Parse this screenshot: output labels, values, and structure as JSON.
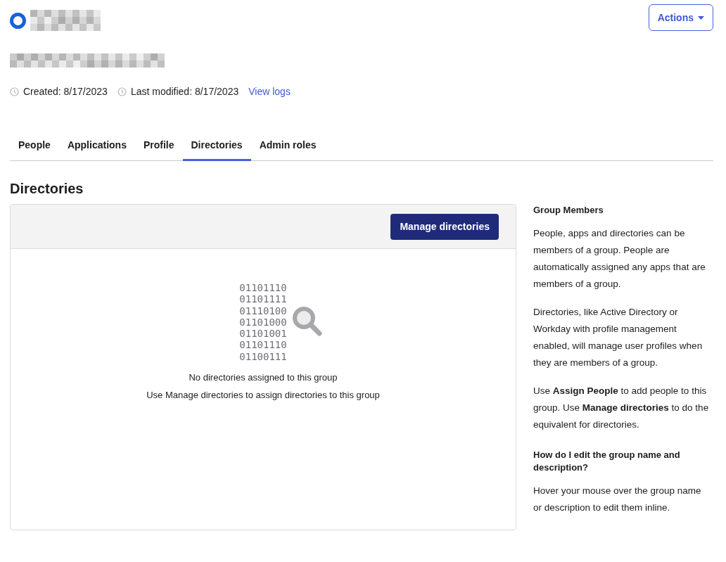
{
  "header": {
    "name_redacted": true,
    "description_redacted": true,
    "actions_button": "Actions"
  },
  "meta": {
    "created": "Created: 8/17/2023",
    "modified": "Last modified: 8/17/2023",
    "link": "View logs"
  },
  "tabs": [
    {
      "label": "People",
      "selected": false
    },
    {
      "label": "Applications",
      "selected": false
    },
    {
      "label": "Profile",
      "selected": false
    },
    {
      "label": "Directories",
      "selected": true
    },
    {
      "label": "Admin roles",
      "selected": false
    }
  ],
  "section_title": "Directories",
  "panel": {
    "button": "Manage directories",
    "binary_lines": [
      "01101110",
      "01101111",
      "01110100",
      "01101000",
      "01101001",
      "01101110",
      "01100111"
    ],
    "empty_title": "No directories assigned to this group",
    "empty_hint": "Use Manage directories to assign directories to this group"
  },
  "help": [
    {
      "kind": "heading",
      "text": "Group Members"
    },
    {
      "kind": "paragraph",
      "text": "People, apps and directories can be members of a group. People are automatically assigned any apps that are members of a group."
    },
    {
      "kind": "paragraph",
      "text": "Directories, like Active Directory or Workday with profile management enabled, will manage user profiles when they are members of a group."
    },
    {
      "kind": "paragraph",
      "text": "Use **Assign People** to add people to this group. Use **Manage directories** to do the equivalent for directories."
    },
    {
      "kind": "heading",
      "text": "How do I edit the group name and description?"
    },
    {
      "kind": "paragraph",
      "text": "Hover your mouse over the group name or description to edit them inline."
    }
  ]
}
